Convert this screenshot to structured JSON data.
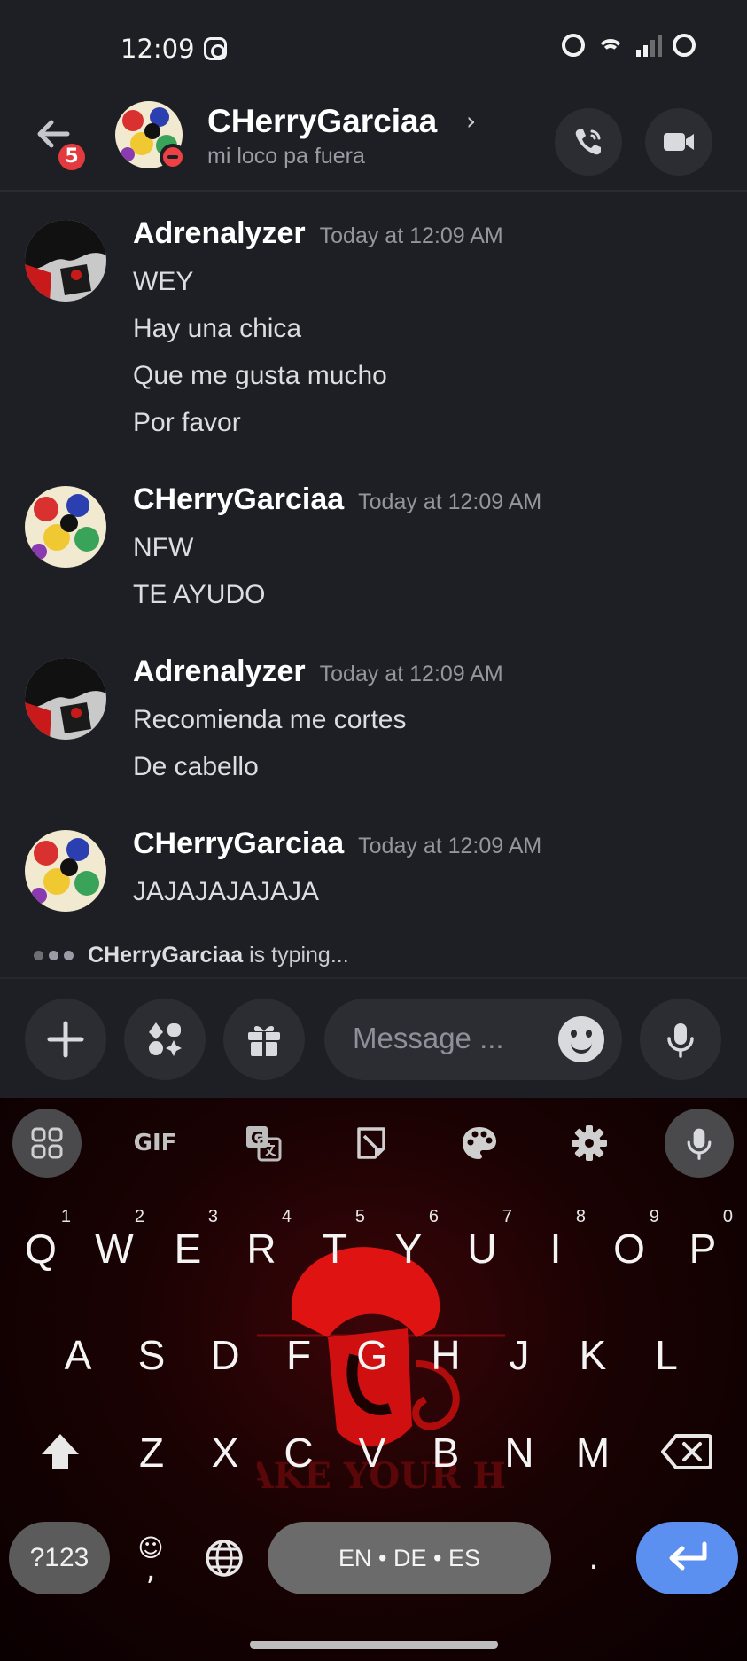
{
  "status_bar": {
    "time": "12:09",
    "icons": [
      "instagram-icon",
      "alarm-icon",
      "wifi-icon",
      "signal-icon",
      "battery-icon"
    ]
  },
  "header": {
    "unread_count": "5",
    "name": "CHerryGarciaa",
    "chevron": "›",
    "status": "mi loco pa fuera",
    "icons": [
      "back-arrow-icon",
      "call-icon",
      "video-icon"
    ]
  },
  "messages": [
    {
      "author": "Adrenalyzer",
      "time": "Today at 12:09 AM",
      "lines": [
        "WEY",
        "Hay una chica",
        "Que me gusta mucho",
        "Por favor"
      ]
    },
    {
      "author": "CHerryGarciaa",
      "time": "Today at 12:09 AM",
      "lines": [
        "NFW",
        "TE AYUDO"
      ]
    },
    {
      "author": "Adrenalyzer",
      "time": "Today at 12:09 AM",
      "lines": [
        "Recomienda me cortes",
        "De cabello"
      ]
    },
    {
      "author": "CHerryGarciaa",
      "time": "Today at 12:09 AM",
      "lines": [
        "JAJAJAJAJAJA"
      ]
    }
  ],
  "typing": {
    "user": "CHerryGarciaa",
    "text": "is typing..."
  },
  "composer": {
    "placeholder": "Message ..."
  },
  "keyboard": {
    "toolbar": {
      "gif": "GIF"
    },
    "row1": [
      {
        "k": "Q",
        "n": "1"
      },
      {
        "k": "W",
        "n": "2"
      },
      {
        "k": "E",
        "n": "3"
      },
      {
        "k": "R",
        "n": "4"
      },
      {
        "k": "T",
        "n": "5"
      },
      {
        "k": "Y",
        "n": "6"
      },
      {
        "k": "U",
        "n": "7"
      },
      {
        "k": "I",
        "n": "8"
      },
      {
        "k": "O",
        "n": "9"
      },
      {
        "k": "P",
        "n": "0"
      }
    ],
    "row2": [
      "A",
      "S",
      "D",
      "F",
      "G",
      "H",
      "J",
      "K",
      "L"
    ],
    "row3": [
      "Z",
      "X",
      "C",
      "V",
      "B",
      "N",
      "M"
    ],
    "symbols": "?123",
    "emoji_comma_top": "☺",
    "emoji_comma_bottom": ",",
    "space": "EN • DE • ES",
    "period": "."
  },
  "colors": {
    "background": "#1e1f24",
    "accent_enter": "#5b8ff0",
    "badge_red": "#e23a3f",
    "dnd_red": "#ed4245"
  }
}
